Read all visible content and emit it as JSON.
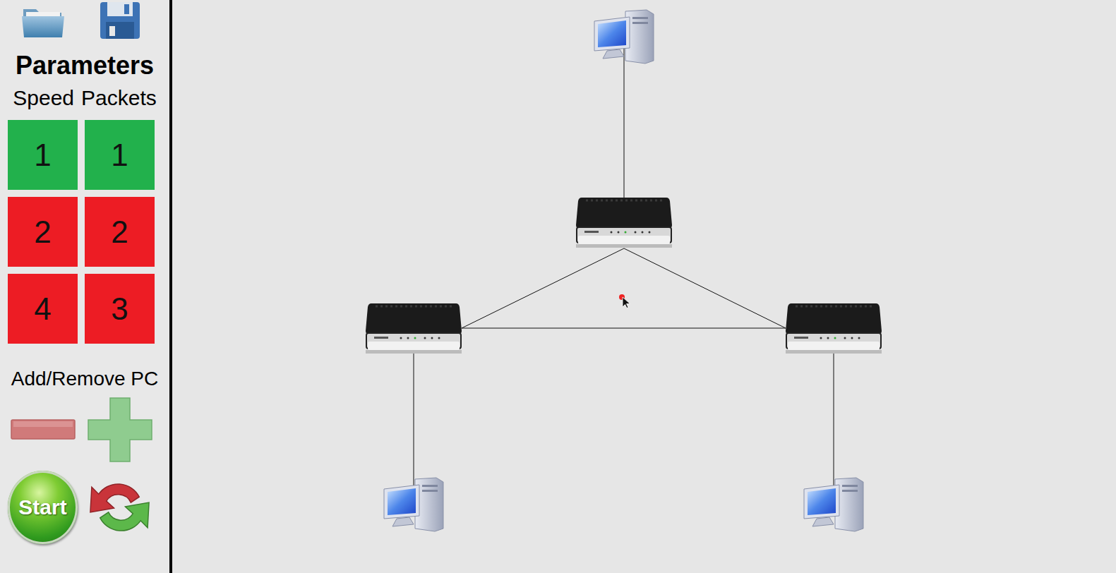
{
  "sidebar": {
    "title": "Parameters",
    "columns": [
      {
        "label": "Speed",
        "options": [
          {
            "value": "1",
            "selected": true
          },
          {
            "value": "2",
            "selected": false
          },
          {
            "value": "4",
            "selected": false
          }
        ]
      },
      {
        "label": "Packets",
        "options": [
          {
            "value": "1",
            "selected": true
          },
          {
            "value": "2",
            "selected": false
          },
          {
            "value": "3",
            "selected": false
          }
        ]
      }
    ],
    "pc_label": "Add/Remove PC",
    "start": "Start"
  },
  "diagram": {
    "nodes": [
      {
        "kind": "pc"
      },
      {
        "kind": "router"
      },
      {
        "kind": "router"
      },
      {
        "kind": "router"
      },
      {
        "kind": "pc"
      },
      {
        "kind": "pc"
      }
    ],
    "links": [
      [
        0,
        1
      ],
      [
        1,
        2
      ],
      [
        1,
        3
      ],
      [
        2,
        3
      ],
      [
        2,
        4
      ],
      [
        3,
        5
      ]
    ]
  }
}
